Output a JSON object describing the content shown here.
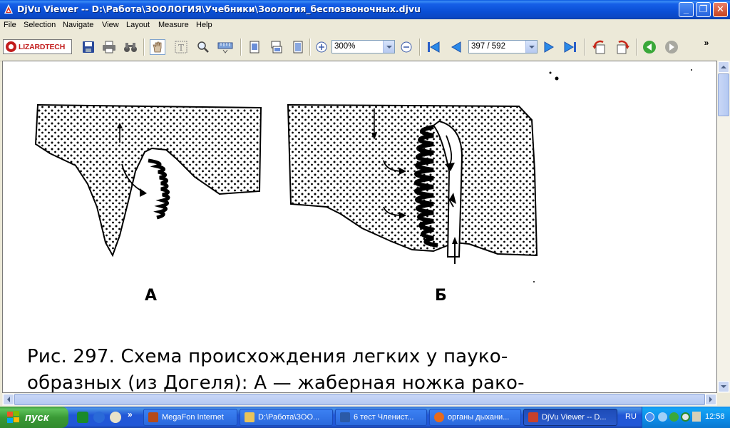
{
  "window": {
    "title": "DjVu Viewer -- D:\\Работа\\ЗООЛОГИЯ\\Учебники\\Зоология_беспозвоночных.djvu",
    "buttons": {
      "minimize": "_",
      "maximize": "❐",
      "close": "✕"
    }
  },
  "menu": [
    "File",
    "Selection",
    "Navigate",
    "View",
    "Layout",
    "Measure",
    "Help"
  ],
  "toolbar": {
    "logo_text": "LIZARDTECH",
    "zoom_value": "300%",
    "page_value": "397 / 592",
    "overflow": "»"
  },
  "document": {
    "figure_labels": [
      "А",
      "Б"
    ],
    "caption_lines": [
      "Рис. 297. Схема происхождения легких у пауко-",
      "образных (из Догеля): А — жаберная ножка рако-"
    ]
  },
  "taskbar": {
    "start_label": "пуск",
    "quick_launch_overflow": "»",
    "tasks": [
      {
        "label": "MegaFon Internet",
        "icon_color": "#b54a1a",
        "active": false
      },
      {
        "label": "D:\\Работа\\ЗОО...",
        "icon_color": "#e9c45a",
        "active": false
      },
      {
        "label": "6 тест Членист...",
        "icon_color": "#2b5aa8",
        "active": false
      },
      {
        "label": "органы дыхани...",
        "icon_color": "#e86a1a",
        "active": false
      },
      {
        "label": "DjVu Viewer -- D...",
        "icon_color": "#c8402a",
        "active": true
      }
    ],
    "language": "RU",
    "clock": "12:58"
  }
}
